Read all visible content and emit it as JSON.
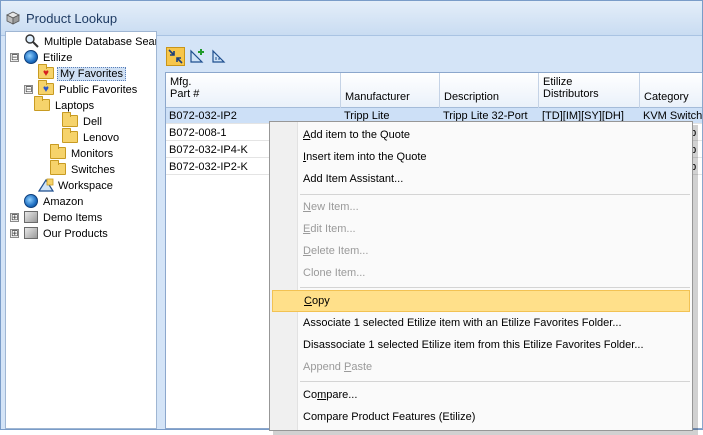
{
  "window": {
    "title": "Product Lookup"
  },
  "tree": {
    "items": [
      {
        "label": "Multiple Database Sear",
        "icon": "magnifier-icon"
      },
      {
        "label": "Etilize",
        "icon": "globe-icon",
        "expander": "⊟"
      },
      {
        "label": "My Favorites",
        "icon": "heart-folder-icon",
        "selected": true
      },
      {
        "label": "Public Favorites",
        "icon": "heart-folder-icon",
        "expander": "⊟"
      },
      {
        "label": "Laptops",
        "icon": "folder-open-icon"
      },
      {
        "label": "Dell",
        "icon": "folder-icon"
      },
      {
        "label": "Lenovo",
        "icon": "folder-icon"
      },
      {
        "label": "Monitors",
        "icon": "folder-icon"
      },
      {
        "label": "Switches",
        "icon": "folder-icon"
      },
      {
        "label": "Workspace",
        "icon": "workspace-icon"
      },
      {
        "label": "Amazon",
        "icon": "globe-icon"
      },
      {
        "label": "Demo Items",
        "icon": "box-icon",
        "expander": "⊞"
      },
      {
        "label": "Our Products",
        "icon": "box-icon",
        "expander": "⊞"
      }
    ]
  },
  "toolbar": {
    "buttons": [
      {
        "name": "collapse-arrows-icon"
      },
      {
        "name": "add-triangle-icon"
      },
      {
        "name": "ruler-triangle-icon"
      }
    ]
  },
  "grid": {
    "columns": [
      {
        "line1": "Mfg.",
        "line2": "Part #"
      },
      {
        "line1": "",
        "line2": "Manufacturer"
      },
      {
        "line1": "",
        "line2": "Description"
      },
      {
        "line1": "Etilize",
        "line2": "Distributors"
      },
      {
        "line1": "",
        "line2": "Category"
      }
    ],
    "rows": [
      {
        "part": "B072-032-IP2",
        "manufacturer": "Tripp Lite",
        "description": "Tripp Lite 32-Port",
        "distributors": "[TD][IM][SY][DH]",
        "category": "KVM Switchb"
      },
      {
        "part": "B072-008-1",
        "manufacturer": "",
        "description": "",
        "distributors": "",
        "category": "hb"
      },
      {
        "part": "B072-032-IP4-K",
        "manufacturer": "",
        "description": "",
        "distributors": "",
        "category": "hb"
      },
      {
        "part": "B072-032-IP2-K",
        "manufacturer": "",
        "description": "",
        "distributors": "",
        "category": "hb"
      }
    ]
  },
  "context_menu": {
    "items": [
      {
        "pre": "",
        "ul": "A",
        "post": "dd item to the Quote",
        "disabled": false
      },
      {
        "pre": "",
        "ul": "I",
        "post": "nsert item into the Quote",
        "disabled": false
      },
      {
        "pre": "Add Item Assistant...",
        "ul": "",
        "post": "",
        "disabled": false
      },
      {
        "pre": "",
        "ul": "N",
        "post": "ew Item...",
        "disabled": true
      },
      {
        "pre": "",
        "ul": "E",
        "post": "dit Item...",
        "disabled": true
      },
      {
        "pre": "",
        "ul": "D",
        "post": "elete Item...",
        "disabled": true
      },
      {
        "pre": "Clone Item...",
        "ul": "",
        "post": "",
        "disabled": true
      },
      {
        "pre": "",
        "ul": "C",
        "post": "opy",
        "disabled": false,
        "highlight": true
      },
      {
        "pre": "Associate 1 selected Etilize item with an Etilize Favorites Folder...",
        "ul": "",
        "post": "",
        "disabled": false
      },
      {
        "pre": "Disassociate 1 selected Etilize item from this Etilize Favorites Folder...",
        "ul": "",
        "post": "",
        "disabled": false
      },
      {
        "pre": "Append ",
        "ul": "P",
        "post": "aste",
        "disabled": true
      },
      {
        "pre": "Co",
        "ul": "m",
        "post": "pare...",
        "disabled": false
      },
      {
        "pre": "Compare Product Features (Etilize)",
        "ul": "",
        "post": "",
        "disabled": false
      }
    ]
  }
}
